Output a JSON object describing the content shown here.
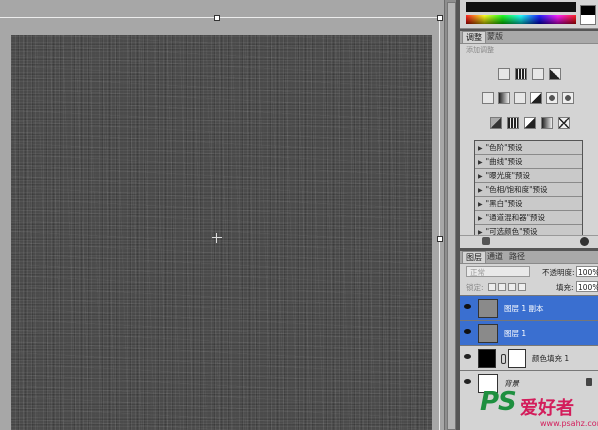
{
  "adjustments_panel": {
    "tabs": [
      "调整",
      "蒙版"
    ],
    "subtitle": "添加调整",
    "icon_rows": [
      [
        "brightness-contrast-icon",
        "levels-icon",
        "curves-icon",
        "exposure-icon"
      ],
      [
        "vibrance-icon",
        "hue-saturation-icon",
        "color-balance-icon",
        "black-white-icon",
        "photo-filter-icon",
        "channel-mixer-icon"
      ],
      [
        "invert-icon",
        "posterize-icon",
        "threshold-icon",
        "gradient-map-icon",
        "selective-color-icon"
      ]
    ],
    "presets": [
      "\"色阶\"预设",
      "\"曲线\"预设",
      "\"曝光度\"预设",
      "\"色相/饱和度\"预设",
      "\"黑白\"预设",
      "\"通道混和器\"预设",
      "\"可选颜色\"预设"
    ]
  },
  "layers_panel": {
    "tabs": [
      "图层",
      "通道",
      "路径"
    ],
    "blend_mode": "正常",
    "opacity_label": "不透明度:",
    "opacity_value": "100%",
    "lock_label": "锁定:",
    "fill_label": "填充:",
    "fill_value": "100%",
    "layers": [
      {
        "name": "图层 1 副本",
        "selected": true,
        "thumb": "#8a8a8a"
      },
      {
        "name": "图层 1",
        "selected": true,
        "thumb": "#8a8a8a"
      },
      {
        "name": "颜色填充 1",
        "selected": false,
        "thumb": "#000000",
        "has_mask": true
      },
      {
        "name": "背景",
        "selected": false,
        "thumb": "#ffffff",
        "locked": true
      }
    ]
  },
  "watermark": {
    "logo_text": "PS",
    "title": "爱好者",
    "url": "www.psahz.com"
  },
  "colors": {
    "canvas": "#4b4b4b",
    "selection": "#3a6fd0",
    "watermark_green": "#1e8f3f",
    "watermark_pink": "#d31d5b"
  }
}
